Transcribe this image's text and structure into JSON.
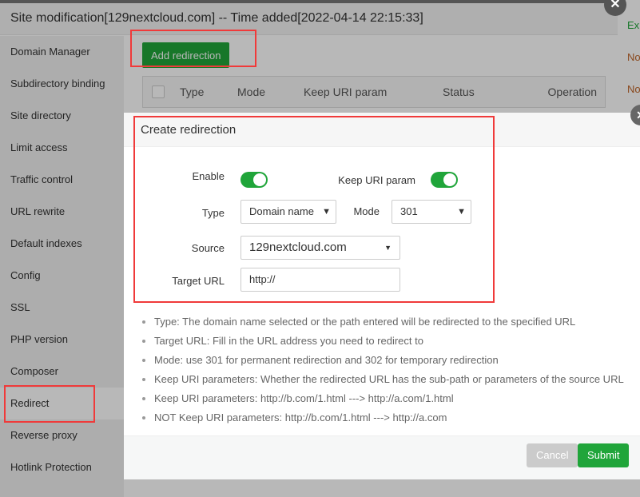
{
  "background_page": {
    "cells": [
      "Exp",
      "No",
      "No"
    ]
  },
  "site_dialog": {
    "title": "Site modification[129nextcloud.com] -- Time added[2022-04-14 22:15:33]",
    "sidebar": [
      "Domain Manager",
      "Subdirectory binding",
      "Site directory",
      "Limit access",
      "Traffic control",
      "URL rewrite",
      "Default indexes",
      "Config",
      "SSL",
      "PHP version",
      "Composer",
      "Redirect",
      "Reverse proxy",
      "Hotlink Protection"
    ],
    "active_item": "Redirect",
    "add_button": "Add redirection",
    "table_headers": [
      "Type",
      "Mode",
      "Keep URI param",
      "Status",
      "Operation"
    ]
  },
  "modal": {
    "title": "Create redirection",
    "enable_label": "Enable",
    "enable_on": true,
    "keep_uri_label": "Keep URI param",
    "keep_uri_on": true,
    "type_label": "Type",
    "type_value": "Domain name",
    "mode_label": "Mode",
    "mode_value": "301",
    "source_label": "Source",
    "source_value": "129nextcloud.com",
    "target_label": "Target URL",
    "target_value": "http://",
    "notes": [
      "Type: The domain name selected or the path entered will be redirected to the specified URL",
      "Target URL: Fill in the URL address you need to redirect to",
      "Mode: use 301 for permanent redirection and 302 for temporary redirection",
      "Keep URI parameters: Whether the redirected URL has the sub-path or parameters of the source URL",
      "Keep URI parameters: http://b.com/1.html ---> http://a.com/1.html",
      "NOT Keep URI parameters: http://b.com/1.html ---> http://a.com"
    ],
    "cancel": "Cancel",
    "submit": "Submit"
  },
  "colors": {
    "accent": "#20a53a",
    "highlight": "#f03a3a"
  }
}
